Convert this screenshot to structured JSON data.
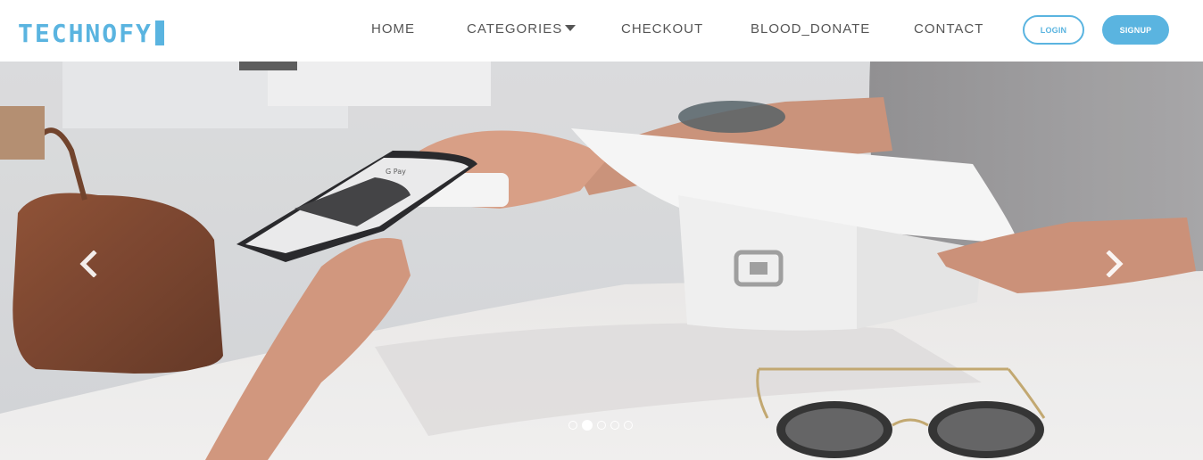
{
  "brand": {
    "name": "TECHNOFY",
    "color": "#5ab4e0"
  },
  "nav": {
    "home": "HOME",
    "categories": "CATEGORIES",
    "checkout": "CHECKOUT",
    "blood_donate": "BLOOD_DONATE",
    "contact": "CONTACT"
  },
  "auth": {
    "login": "LOGIN",
    "signup": "SIGNUP"
  },
  "carousel": {
    "slide_image": "payment-terminal-photo",
    "prev_icon": "chevron-left-icon",
    "next_icon": "chevron-right-icon",
    "slide_count": 5,
    "active_slide": 2,
    "phone_screen_text": "G Pay"
  },
  "colors": {
    "accent": "#5ab4e0",
    "nav_text": "#555555"
  }
}
